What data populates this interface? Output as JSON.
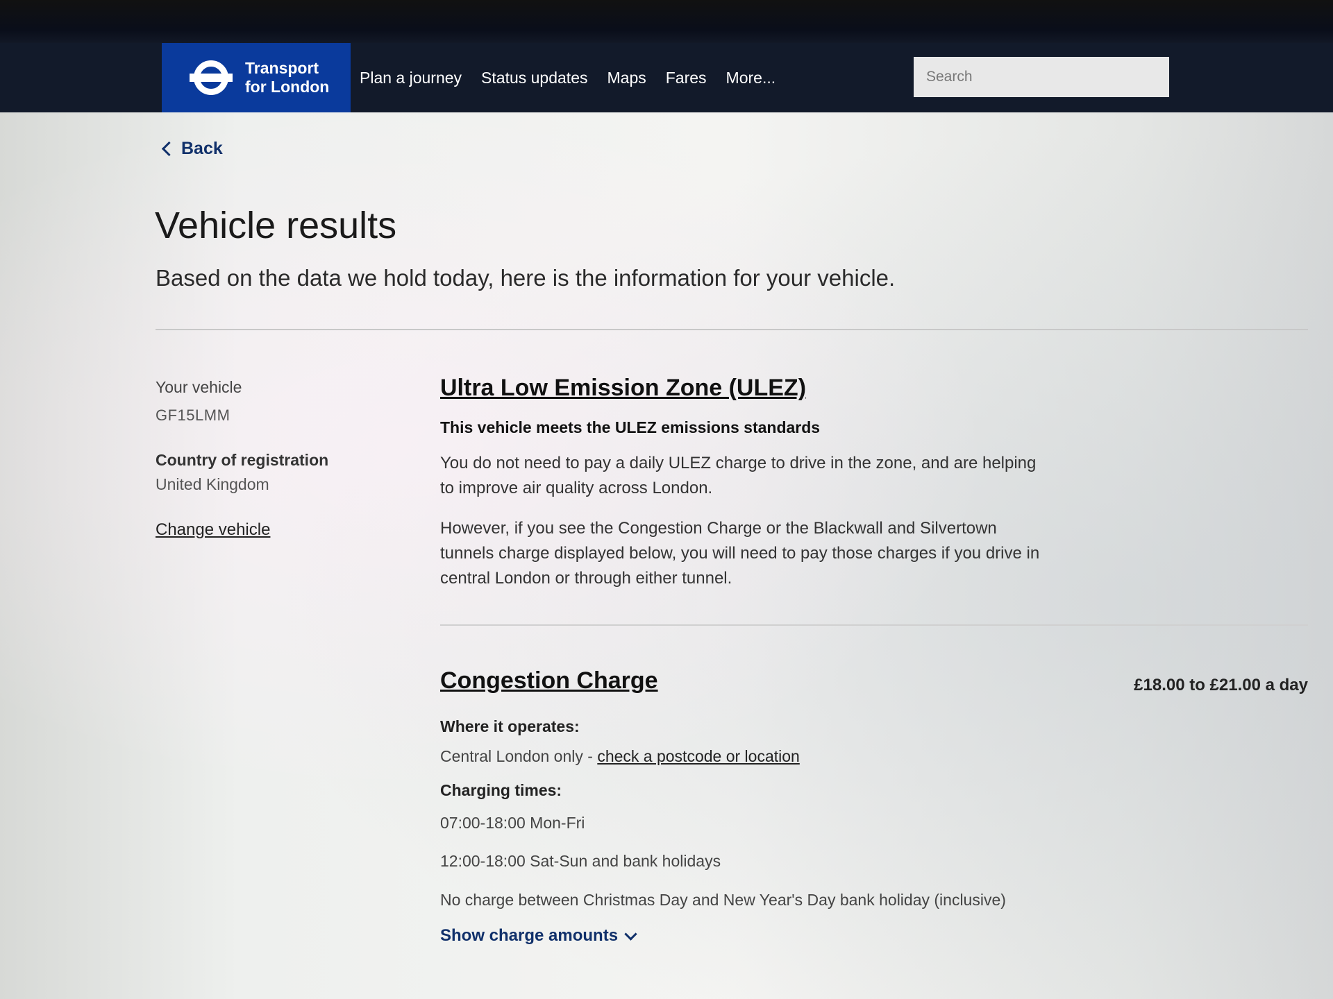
{
  "header": {
    "logo_line1": "Transport",
    "logo_line2": "for London",
    "nav": [
      "Plan a journey",
      "Status updates",
      "Maps",
      "Fares",
      "More..."
    ],
    "search_placeholder": "Search"
  },
  "back_label": "Back",
  "page": {
    "title": "Vehicle results",
    "subtitle": "Based on the data we hold today, here is the information for your vehicle."
  },
  "sidebar": {
    "vehicle_label": "Your vehicle",
    "vehicle_reg": "GF15LMM",
    "country_label": "Country of registration",
    "country_value": "United Kingdom",
    "change_link": "Change vehicle"
  },
  "ulez": {
    "title": "Ultra Low Emission Zone (ULEZ)",
    "status": "This vehicle meets the ULEZ emissions standards",
    "para1": "You do not need to pay a daily ULEZ charge to drive in the zone, and are helping to improve air quality across London.",
    "para2": "However, if you see the Congestion Charge or the Blackwall and Silvertown tunnels charge displayed below, you will need to pay those charges if you drive in central London or through either tunnel."
  },
  "congestion": {
    "title": "Congestion Charge",
    "price": "£18.00 to £21.00 a day",
    "where_label": "Where it operates:",
    "where_text": "Central London only - ",
    "where_link": "check a postcode or location",
    "times_label": "Charging times:",
    "time1": "07:00-18:00 Mon-Fri",
    "time2": "12:00-18:00 Sat-Sun and bank holidays",
    "note": "No charge between Christmas Day and New Year's Day bank holiday (inclusive)",
    "show_amounts": "Show charge amounts"
  }
}
